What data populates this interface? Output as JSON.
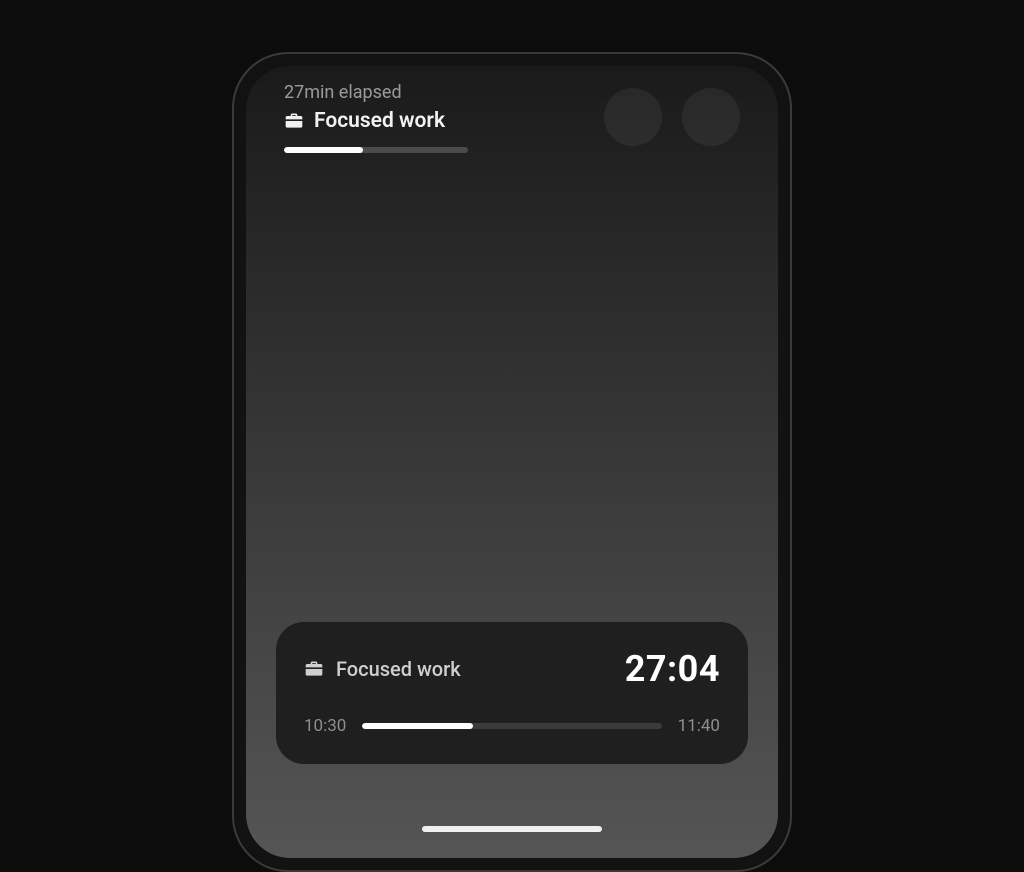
{
  "live_activity": {
    "elapsed_label": "27min elapsed",
    "title": "Focused work",
    "progress_percent": 43
  },
  "timer_card": {
    "title": "Focused work",
    "timer": "27:04",
    "start_label": "10:30",
    "end_label": "11:40",
    "progress_percent": 37
  }
}
